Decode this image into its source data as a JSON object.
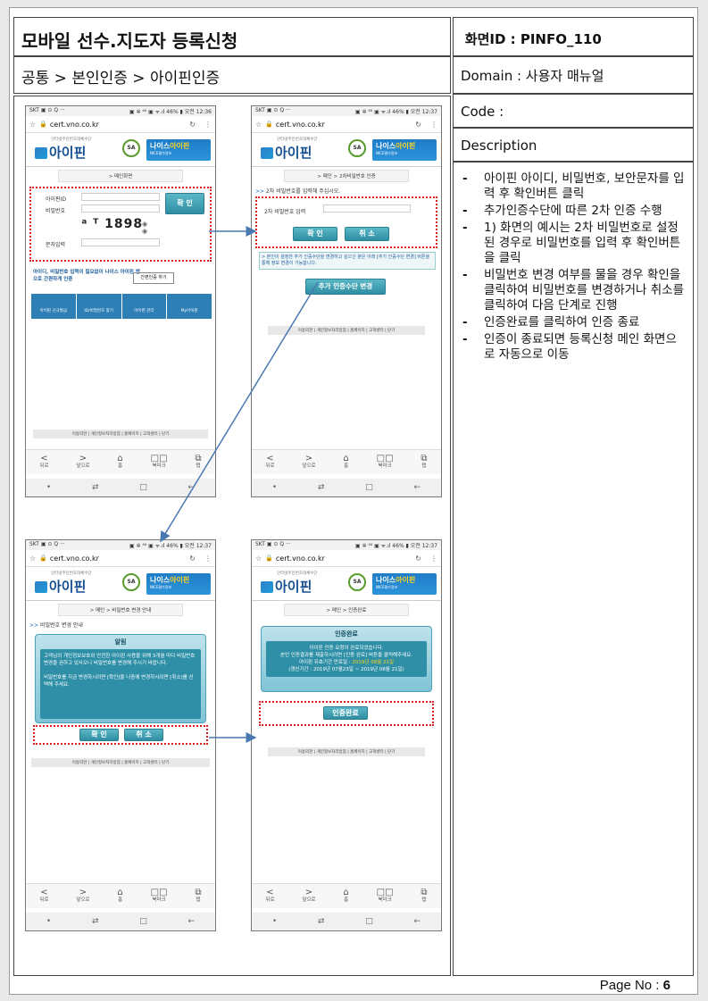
{
  "header": {
    "title": "모바일 선수.지도자 등록신청",
    "breadcrumb": "공통 > 본인인증 > 아이핀인증",
    "screen_id_label": "화면ID : ",
    "screen_id_value": "PINFO_110",
    "domain": "Domain : 사용자 매뉴얼",
    "code": "Code :",
    "description_label": "Description"
  },
  "description": [
    "아이핀 아이디, 비밀번호, 보안문자를 입력 후 확인버튼 클릭",
    "추가인증수단에 따른 2차 인증 수행",
    "1) 화면의 예시는 2차 비밀번호로 설정된 경우로 비밀번호를 입력 후 확인버튼을 클릭",
    "비밀번호 변경 여부를 물을 경우 확인을 클릭하여 비밀번호를 변경하거나 취소를 클릭하여 다음 단계로 진행",
    "인증완료를 클릭하여 인증 종료",
    "인증이 종료되면 등록신청 메인 화면으로 자동으로 이동"
  ],
  "page_no_label": "Page No : ",
  "page_no": "6",
  "phone_common": {
    "status_left": "SKT ▣ ⊙ Q ···",
    "status_right_1": "▣ ✲ ⁴⁶ ▣ ᯤ.ıl 46% ▮ 오전 12:36",
    "status_right_2": "▣ ✲ ⁴⁶ ▣ ᯤ.ıl 46% ▮ 오전 12:37",
    "url": "cert.vno.co.kr",
    "logo_sub": "인터넷주민번호대체수단",
    "logo_text": "아이핀",
    "nice_text": "나이스",
    "nice_hl": "아이핀",
    "nice_sub": "NICE평가정보",
    "seal": "SA",
    "footer": "이용약관 | 개인정보처리방침 | 홈페이지 | 고객센터 | 닫기",
    "nav": [
      {
        "icon": "<",
        "label": "뒤로"
      },
      {
        "icon": ">",
        "label": "앞으로"
      },
      {
        "icon": "⌂",
        "label": "홈"
      },
      {
        "icon": "□□",
        "label": "북마크"
      },
      {
        "icon": "⧉",
        "label": "탭"
      }
    ],
    "sys": [
      "•",
      "⇄",
      "□",
      "←"
    ]
  },
  "phone1": {
    "breadcrumb": "> 메인화면",
    "id_label": "아이핀ID",
    "pw_label": "비밀번호",
    "captcha": "ᵃ ᵀ 1898",
    "char_label": "문자입력",
    "confirm": "확 인",
    "promo": "아이디, 비밀번호 입력이 필요없이 나이스 아이핀 앱으로 간편하게 인증",
    "promo_btn": "간편인증 하기",
    "tiles": [
      "아이핀 신규발급",
      "ID/비밀번호 찾기",
      "아이핀 관리",
      "My아이핀"
    ]
  },
  "phone2": {
    "breadcrumb": "> 메인 > 2차비밀번호 인증",
    "heading": "2차 비밀번호를 입력해 주십시오.",
    "pw2_label": "2차 비밀번호 입력",
    "confirm": "확 인",
    "cancel": "취 소",
    "note": "> 본인이 설정한 추가 인증수단을 변경하고 싶으신 분은 아래 [추가 인증수단 변경] 버튼을 통해 정보 변경이 가능합니다.",
    "change_btn": "추가 인증수단 변경"
  },
  "phone3": {
    "breadcrumb": "> 메인 > 비밀번호 변경 안내",
    "heading": "비밀번호 변경 안내",
    "dialog_title": "알림",
    "dialog_body": "고객님의 개인정보보호와 안전한 아이핀 사용을 위해 3개월 마다 비밀번호 변경을 권하고 있사오니 비밀번호를 변경해 주시기 바랍니다.",
    "dialog_body2": "비밀번호를 지금 변경하시려면 [확인]을 나중에 변경하시려면 [취소]를 선택해 주세요.",
    "confirm": "확 인",
    "cancel": "취 소"
  },
  "phone4": {
    "breadcrumb": "> 메인 > 인증완료",
    "dialog_title": "인증완료",
    "line1": "아이핀 인증 요청이 완료되었습니다.",
    "line2": "본인 인증결과를 제출하시려면 [인증 완료] 버튼을 클릭해주세요.",
    "line3a": "아이핀 유효기간 만료일 : ",
    "line3b": "2019년 08월 21일",
    "line4": "(갱신기간 : 2019년 07월23일 ~ 2019년 08월 21일)",
    "done_btn": "인증완료"
  },
  "colors": {
    "highlight": "#d81d1d",
    "arrow": "#4a78b0",
    "button": "#2f8ea3"
  }
}
